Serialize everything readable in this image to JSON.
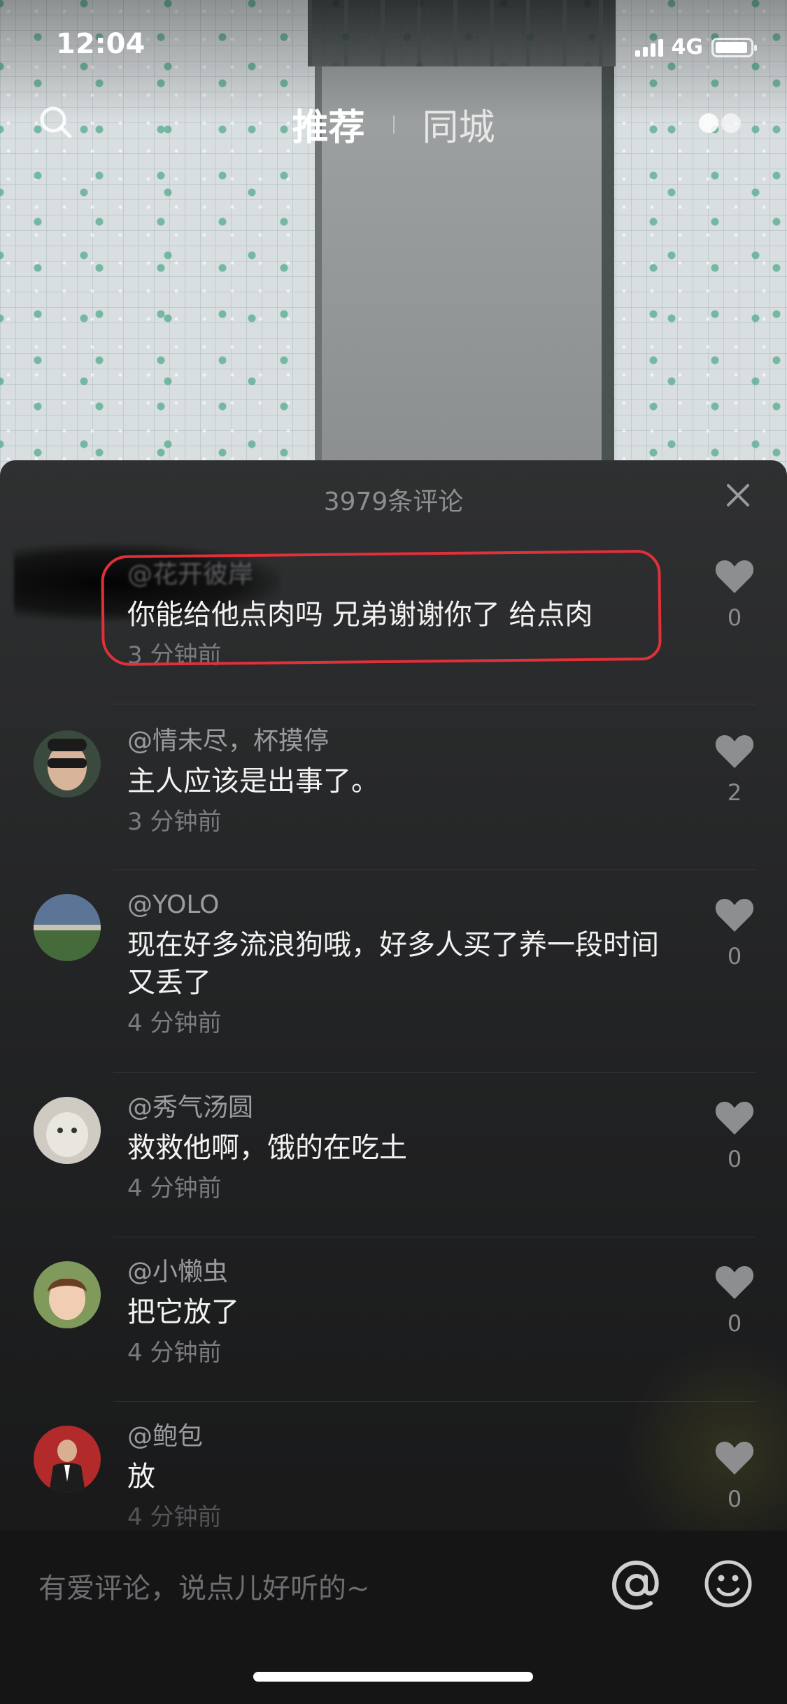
{
  "status_bar": {
    "time": "12:04",
    "network": "4G"
  },
  "top_nav": {
    "tabs": [
      {
        "label": "推荐",
        "active": true
      },
      {
        "label": "同城",
        "active": false
      }
    ],
    "icons": [
      "search-icon",
      "live-icon"
    ]
  },
  "comments_panel": {
    "header": "3979条评论",
    "close_icon": "close-icon",
    "comments": [
      {
        "username": "@花开彼岸",
        "text": "你能给他点肉吗 兄弟谢谢你了 给点肉",
        "time": "3 分钟前",
        "likes": "0",
        "highlighted": true
      },
      {
        "username": "@情未尽，杯摸停",
        "text": "主人应该是出事了。",
        "time": "3 分钟前",
        "likes": "2"
      },
      {
        "username": "@YOLO",
        "text": "现在好多流浪狗哦，好多人买了养一段时间又丢了",
        "time": "4 分钟前",
        "likes": "0"
      },
      {
        "username": "@秀气汤圆",
        "text": "救救他啊，饿的在吃土",
        "time": "4 分钟前",
        "likes": "0"
      },
      {
        "username": "@小懒虫",
        "text": "把它放了",
        "time": "4 分钟前",
        "likes": "0"
      },
      {
        "username": "@鲍包",
        "text": "放",
        "time": "4 分钟前",
        "likes": "0"
      }
    ]
  },
  "input_bar": {
    "placeholder": "有爱评论，说点儿好听的~",
    "icons": [
      "at-icon",
      "emoji-icon"
    ]
  },
  "colors": {
    "highlight": "#e0303a",
    "sheet_bg": "#2a2b2c",
    "muted_text": "#9b9ca0"
  }
}
